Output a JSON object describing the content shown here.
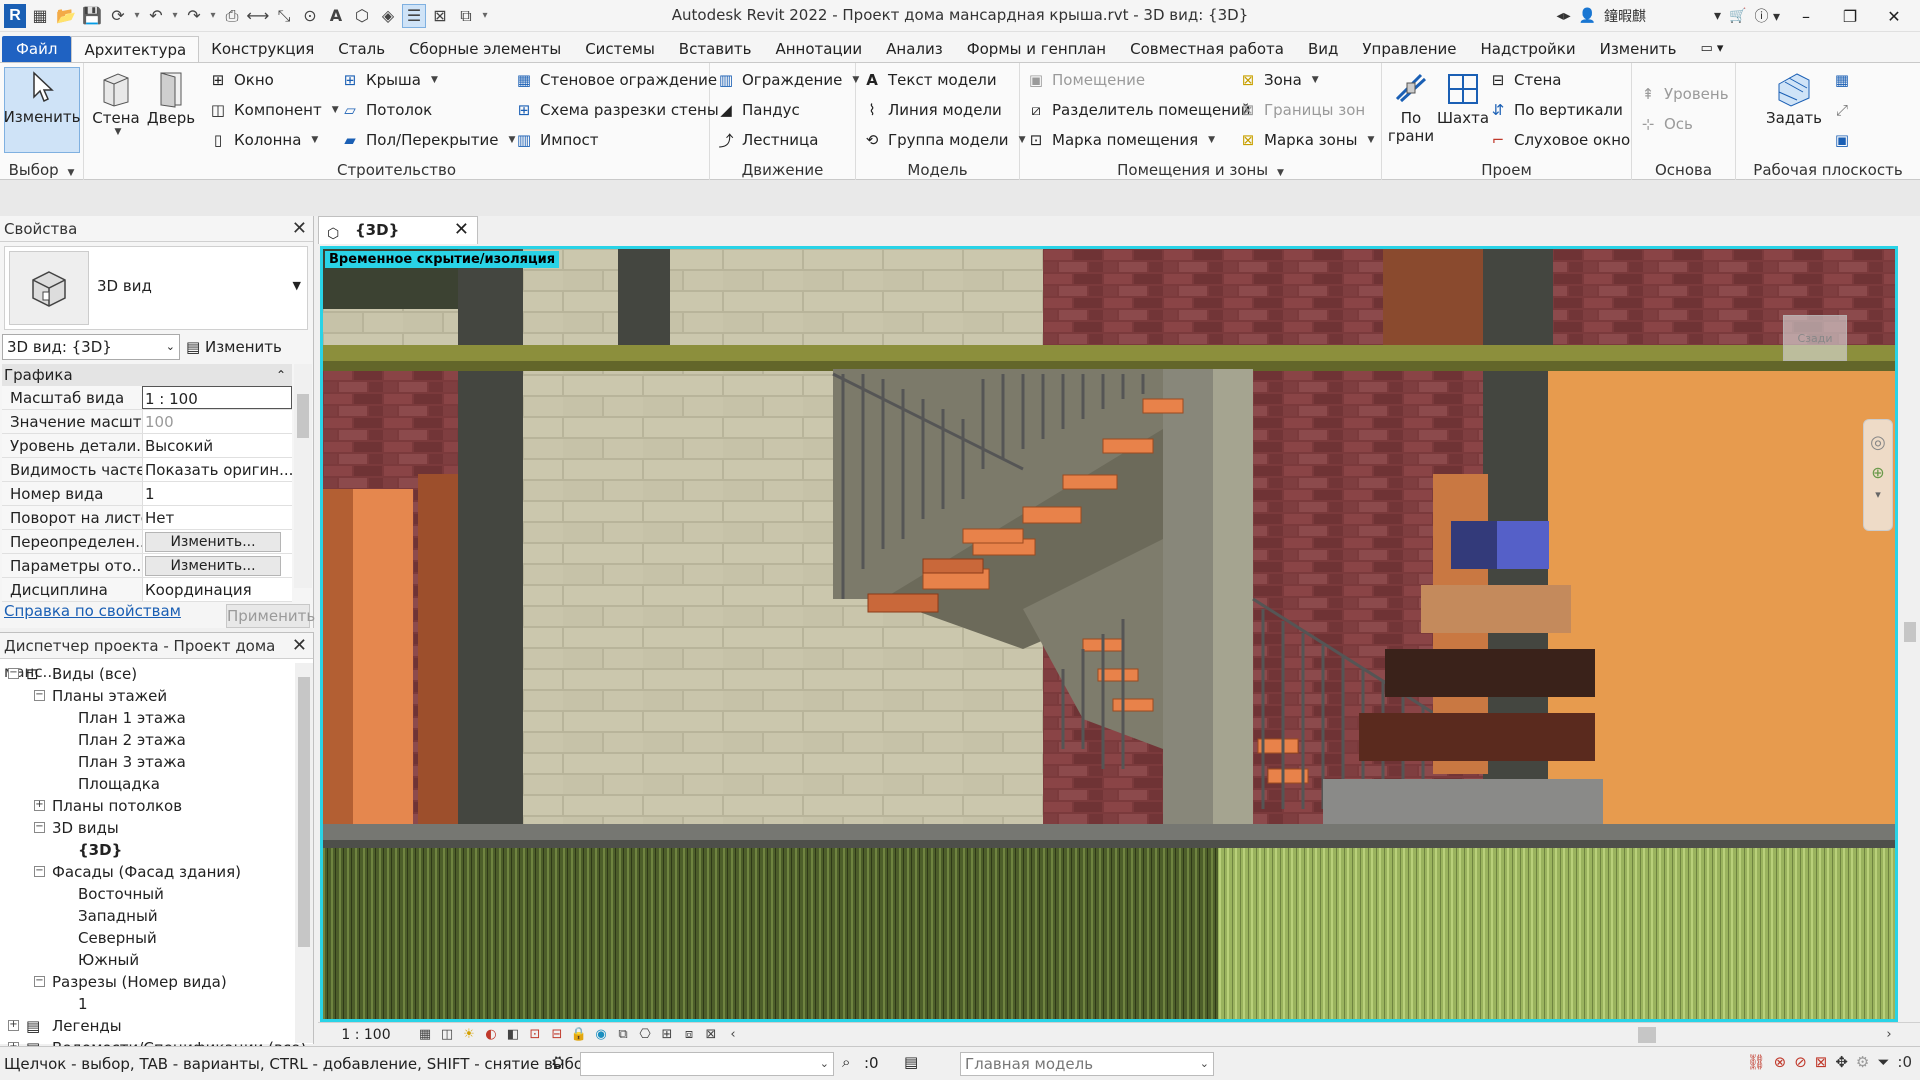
{
  "app": {
    "title": "Autodesk Revit 2022 - Проект дома мансардная крыша.rvt - 3D вид: {3D}",
    "user": "鐘暇麒"
  },
  "tabs": [
    {
      "label": "Файл"
    },
    {
      "label": "Архитектура"
    },
    {
      "label": "Конструкция"
    },
    {
      "label": "Сталь"
    },
    {
      "label": "Сборные элементы"
    },
    {
      "label": "Системы"
    },
    {
      "label": "Вставить"
    },
    {
      "label": "Аннотации"
    },
    {
      "label": "Анализ"
    },
    {
      "label": "Формы и генплан"
    },
    {
      "label": "Совместная работа"
    },
    {
      "label": "Вид"
    },
    {
      "label": "Управление"
    },
    {
      "label": "Надстройки"
    },
    {
      "label": "Изменить"
    }
  ],
  "ribbon": {
    "select": {
      "modify": "Изменить",
      "title": "Выбор"
    },
    "build": {
      "title": "Строительство",
      "wall": "Стена",
      "door": "Дверь",
      "window": "Окно",
      "component": "Компонент",
      "column": "Колонна",
      "roof": "Крыша",
      "ceiling": "Потолок",
      "floor": "Пол/Перекрытие",
      "curtain": "Стеновое ограждение",
      "curtain_grid": "Схема разрезки стены",
      "mullion": "Импост"
    },
    "circulation": {
      "title": "Движение",
      "railing": "Ограждение",
      "ramp": "Пандус",
      "stair": "Лестница"
    },
    "model": {
      "title": "Модель",
      "text": "Текст модели",
      "line": "Линия модели",
      "group": "Группа модели"
    },
    "rooms": {
      "title": "Помещения и зоны",
      "room": "Помещение",
      "separator": "Разделитель помещений",
      "room_tag": "Марка помещения",
      "area": "Зона",
      "area_boundary": "Границы зон",
      "area_tag": "Марка зоны"
    },
    "opening": {
      "title": "Проем",
      "by_face": "По\nграни",
      "shaft": "Шахта",
      "wall": "Стена",
      "vertical": "По вертикали",
      "dormer": "Слуховое окно"
    },
    "datum": {
      "title": "Основа",
      "level": "Уровень",
      "grid": "Ось"
    },
    "workplane": {
      "title": "Рабочая плоскость",
      "set": "Задать"
    }
  },
  "properties": {
    "header": "Свойства",
    "type_name": "3D вид",
    "view_selector": "3D вид: {3D}",
    "edit_type": "Изменить тип",
    "group": "Графика",
    "rows": [
      {
        "k": "Масштаб вида",
        "v": "1 : 100"
      },
      {
        "k": "Значение масшт...",
        "v": "100"
      },
      {
        "k": "Уровень детали...",
        "v": "Высокий"
      },
      {
        "k": "Видимость частей",
        "v": "Показать оригин..."
      },
      {
        "k": "Номер вида",
        "v": "1"
      },
      {
        "k": "Поворот на листе",
        "v": "Нет"
      },
      {
        "k": "Переопределен...",
        "v": "Изменить..."
      },
      {
        "k": "Параметры ото...",
        "v": "Изменить..."
      },
      {
        "k": "Дисциплина",
        "v": "Координация"
      }
    ],
    "help": "Справка по свойствам",
    "apply": "Применить"
  },
  "browser": {
    "header": "Диспетчер проекта - Проект дома манс...",
    "nodes": [
      {
        "label": "Виды (все)",
        "level": 0,
        "pm": "−"
      },
      {
        "label": "Планы этажей",
        "level": 1,
        "pm": "−"
      },
      {
        "label": "План 1 этажа",
        "level": 2,
        "pm": ""
      },
      {
        "label": "План 2 этажа",
        "level": 2,
        "pm": ""
      },
      {
        "label": "План 3 этажа",
        "level": 2,
        "pm": ""
      },
      {
        "label": "Площадка",
        "level": 2,
        "pm": ""
      },
      {
        "label": "Планы потолков",
        "level": 1,
        "pm": "+"
      },
      {
        "label": "3D виды",
        "level": 1,
        "pm": "−"
      },
      {
        "label": "{3D}",
        "level": 2,
        "pm": "",
        "bold": true
      },
      {
        "label": "Фасады (Фасад здания)",
        "level": 1,
        "pm": "−"
      },
      {
        "label": "Восточный",
        "level": 2,
        "pm": ""
      },
      {
        "label": "Западный",
        "level": 2,
        "pm": ""
      },
      {
        "label": "Северный",
        "level": 2,
        "pm": ""
      },
      {
        "label": "Южный",
        "level": 2,
        "pm": ""
      },
      {
        "label": "Разрезы (Номер вида)",
        "level": 1,
        "pm": "−"
      },
      {
        "label": "1",
        "level": 2,
        "pm": ""
      },
      {
        "label": "Легенды",
        "level": 0,
        "pm": "+"
      },
      {
        "label": "Ведомости/Спецификации (все)",
        "level": 0,
        "pm": "+"
      }
    ]
  },
  "viewport": {
    "tab": "{3D}",
    "badge": "Временное скрытие/изоляция",
    "navcube": "Сзади",
    "scale": "1 : 100"
  },
  "status": {
    "message": "Щелчок - выбор, TAB - варианты, CTRL - добавление, SHIFT - снятие выбора.",
    "worksets": ":0",
    "model": "Главная модель",
    "filter": ":0"
  }
}
